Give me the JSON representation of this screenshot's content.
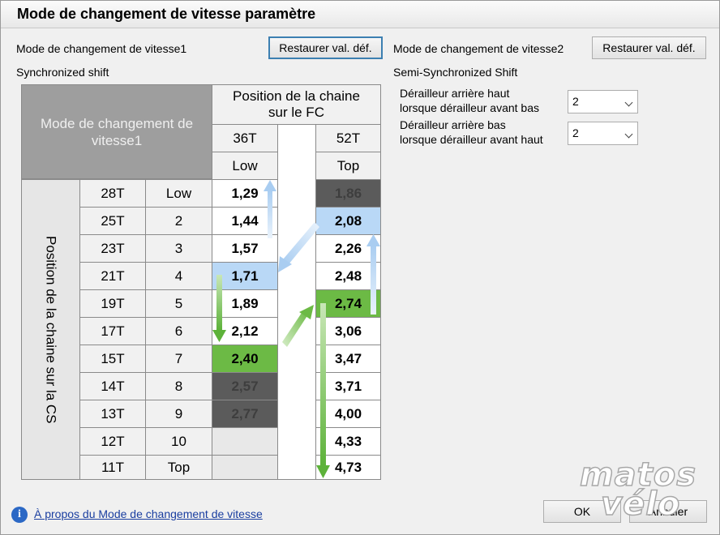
{
  "window": {
    "title": "Mode de changement de vitesse paramètre"
  },
  "mode1": {
    "label": "Mode de changement de vitesse1",
    "restore_label": "Restaurer val. déf.",
    "value": "Synchronized shift"
  },
  "mode2": {
    "label": "Mode de changement de vitesse2",
    "restore_label": "Restaurer val. déf.",
    "value": "Semi-Synchronized Shift",
    "rear_high_label_1": "Dérailleur arrière haut",
    "rear_high_label_2": "lorsque dérailleur avant bas",
    "rear_high_value": "2",
    "rear_low_label_1": "Dérailleur arrière bas",
    "rear_low_label_2": "lorsque dérailleur avant haut",
    "rear_low_value": "2"
  },
  "table": {
    "corner_label_1": "Mode de changement de",
    "corner_label_2": "vitesse1",
    "fc_header_1": "Position de la chaine",
    "fc_header_2": "sur le FC",
    "cs_header": "Position de la chaine sur la CS",
    "front": [
      {
        "teeth": "36T",
        "pos": "Low"
      },
      {
        "teeth": "52T",
        "pos": "Top"
      }
    ],
    "rows": [
      {
        "cog": "28T",
        "pos": "Low",
        "r36": "1,29",
        "r52": "1,86"
      },
      {
        "cog": "25T",
        "pos": "2",
        "r36": "1,44",
        "r52": "2,08"
      },
      {
        "cog": "23T",
        "pos": "3",
        "r36": "1,57",
        "r52": "2,26"
      },
      {
        "cog": "21T",
        "pos": "4",
        "r36": "1,71",
        "r52": "2,48"
      },
      {
        "cog": "19T",
        "pos": "5",
        "r36": "1,89",
        "r52": "2,74"
      },
      {
        "cog": "17T",
        "pos": "6",
        "r36": "2,12",
        "r52": "3,06"
      },
      {
        "cog": "15T",
        "pos": "7",
        "r36": "2,40",
        "r52": "3,47"
      },
      {
        "cog": "14T",
        "pos": "8",
        "r36": "2,57",
        "r52": "3,71"
      },
      {
        "cog": "13T",
        "pos": "9",
        "r36": "2,77",
        "r52": "4,00"
      },
      {
        "cog": "12T",
        "pos": "10",
        "r36": "",
        "r52": "4,33"
      },
      {
        "cog": "11T",
        "pos": "Top",
        "r36": "",
        "r52": "4,73"
      }
    ]
  },
  "footer": {
    "info_link": "À propos du Mode de changement de vitesse",
    "ok_label": "OK",
    "cancel_label": "Annuler"
  },
  "watermark": {
    "line1": "matos",
    "line2": "vélo"
  },
  "colors": {
    "accent_blue": "#b9d8f6",
    "accent_green": "#6cba45",
    "disabled_gray": "#5b5b5b",
    "header_gray": "#9e9e9e"
  }
}
